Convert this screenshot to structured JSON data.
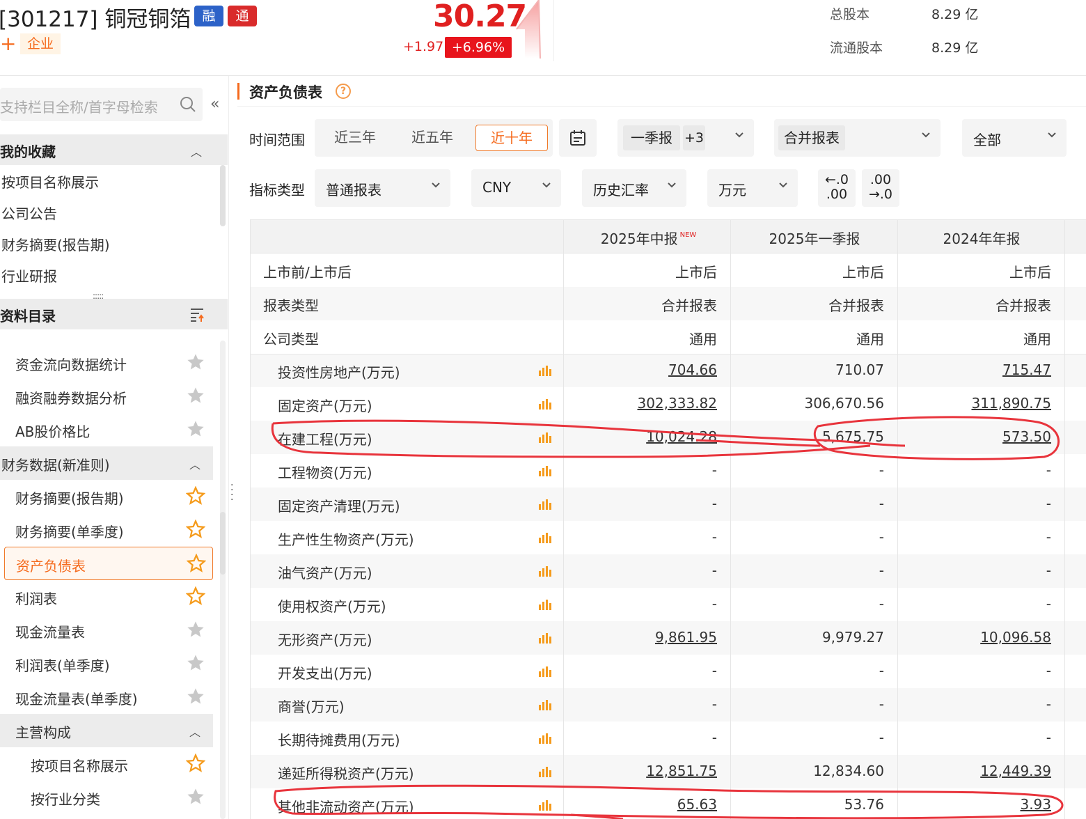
{
  "header": {
    "stock_title": "[301217] 铜冠铜箔",
    "tag_margin": "融",
    "tag_connect": "通",
    "add_icon": "+",
    "enterprise_label": "企业",
    "price": "30.27",
    "change": "+1.97",
    "change_pct": "+6.96%",
    "total_shares_label": "总股本",
    "total_shares_value": "8.29 亿",
    "float_shares_label": "流通股本",
    "float_shares_value": "8.29 亿"
  },
  "sidebar": {
    "search_placeholder": "支持栏目全称/首字母检索",
    "collapse_icon": "«",
    "favorites_title": "我的收藏",
    "favorites": [
      "按项目名称展示",
      "公司公告",
      "财务摘要(报告期)",
      "行业研报"
    ],
    "catalog_title": "资料目录",
    "catalog": [
      {
        "label": "资金流向数据统计",
        "star": "gray"
      },
      {
        "label": "融资融券数据分析",
        "star": "gray"
      },
      {
        "label": "AB股价格比",
        "star": "gray"
      },
      {
        "label": "财务数据(新准则)",
        "group": true
      },
      {
        "label": "财务摘要(报告期)",
        "star": "orange"
      },
      {
        "label": "财务摘要(单季度)",
        "star": "orange"
      },
      {
        "label": "资产负债表",
        "star": "orange",
        "selected": true
      },
      {
        "label": "利润表",
        "star": "orange"
      },
      {
        "label": "现金流量表",
        "star": "gray"
      },
      {
        "label": "利润表(单季度)",
        "star": "gray"
      },
      {
        "label": "现金流量表(单季度)",
        "star": "gray"
      },
      {
        "label": "主营构成",
        "group": true
      },
      {
        "label": "按项目名称展示",
        "star": "orange"
      },
      {
        "label": "按行业分类",
        "star": "gray"
      }
    ]
  },
  "main": {
    "title": "资产负债表",
    "help_icon": "?",
    "time_range_label": "时间范围",
    "time_range_options": [
      "近三年",
      "近五年",
      "近十年"
    ],
    "report_period": "一季报",
    "report_period_more": "+3",
    "statement_type": "合并报表",
    "scope": "全部",
    "indicator_type_label": "指标类型",
    "indicator_type": "普通报表",
    "currency": "CNY",
    "exchange_rate": "历史汇率",
    "unit": "万元",
    "decimal_dec_top": "←.0",
    "decimal_dec_bottom": ".00",
    "decimal_inc_top": ".00",
    "decimal_inc_bottom": "→.0"
  },
  "table": {
    "columns": [
      "2025年中报",
      "2025年一季报",
      "2024年年报"
    ],
    "new_badge": "NEW",
    "rows": [
      {
        "name": "上市前/上市后",
        "values": [
          "上市后",
          "上市后",
          "上市后"
        ],
        "meta": true
      },
      {
        "name": "报表类型",
        "values": [
          "合并报表",
          "合并报表",
          "合并报表"
        ],
        "meta": true
      },
      {
        "name": "公司类型",
        "values": [
          "通用",
          "通用",
          "通用"
        ],
        "meta": true
      },
      {
        "name": "投资性房地产(万元)",
        "values": [
          "704.66",
          "710.07",
          "715.47"
        ]
      },
      {
        "name": "固定资产(万元)",
        "values": [
          "302,333.82",
          "306,670.56",
          "311,890.75"
        ]
      },
      {
        "name": "在建工程(万元)",
        "values": [
          "10,024.28",
          "5,675.75",
          "573.50"
        ]
      },
      {
        "name": "工程物资(万元)",
        "values": [
          "-",
          "-",
          "-"
        ]
      },
      {
        "name": "固定资产清理(万元)",
        "values": [
          "-",
          "-",
          "-"
        ]
      },
      {
        "name": "生产性生物资产(万元)",
        "values": [
          "-",
          "-",
          "-"
        ]
      },
      {
        "name": "油气资产(万元)",
        "values": [
          "-",
          "-",
          "-"
        ]
      },
      {
        "name": "使用权资产(万元)",
        "values": [
          "-",
          "-",
          "-"
        ]
      },
      {
        "name": "无形资产(万元)",
        "values": [
          "9,861.95",
          "9,979.27",
          "10,096.58"
        ]
      },
      {
        "name": "开发支出(万元)",
        "values": [
          "-",
          "-",
          "-"
        ]
      },
      {
        "name": "商誉(万元)",
        "values": [
          "-",
          "-",
          "-"
        ]
      },
      {
        "name": "长期待摊费用(万元)",
        "values": [
          "-",
          "-",
          "-"
        ]
      },
      {
        "name": "递延所得税资产(万元)",
        "values": [
          "12,851.75",
          "12,834.60",
          "12,449.39"
        ]
      },
      {
        "name": "其他非流动资产(万元)",
        "values": [
          "65.63",
          "53.76",
          "3.93"
        ]
      }
    ]
  },
  "colors": {
    "accent": "#f56a1d",
    "up_red": "#e02020",
    "annotation": "#e8343c"
  }
}
